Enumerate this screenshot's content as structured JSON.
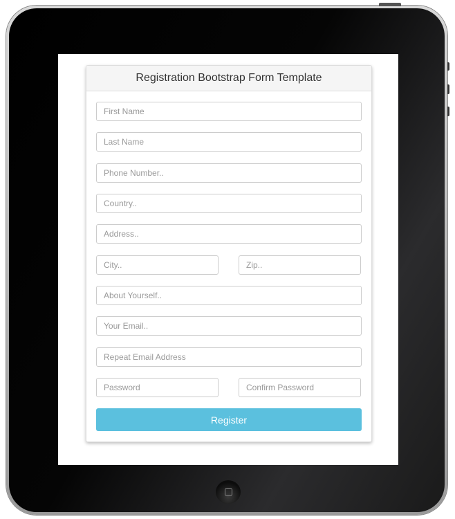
{
  "form": {
    "title": "Registration Bootstrap Form Template",
    "fields": {
      "first_name": "First Name",
      "last_name": "Last Name",
      "phone": "Phone Number..",
      "country": "Country..",
      "address": "Address..",
      "city": "City..",
      "zip": "Zip..",
      "about": "About Yourself..",
      "email": "Your Email..",
      "repeat_email": "Repeat Email Address",
      "password": "Password",
      "confirm_password": "Confirm Password"
    },
    "register_label": "Register"
  },
  "colors": {
    "accent": "#5bc0de"
  },
  "device": {
    "home_icon": "home-button-icon"
  }
}
